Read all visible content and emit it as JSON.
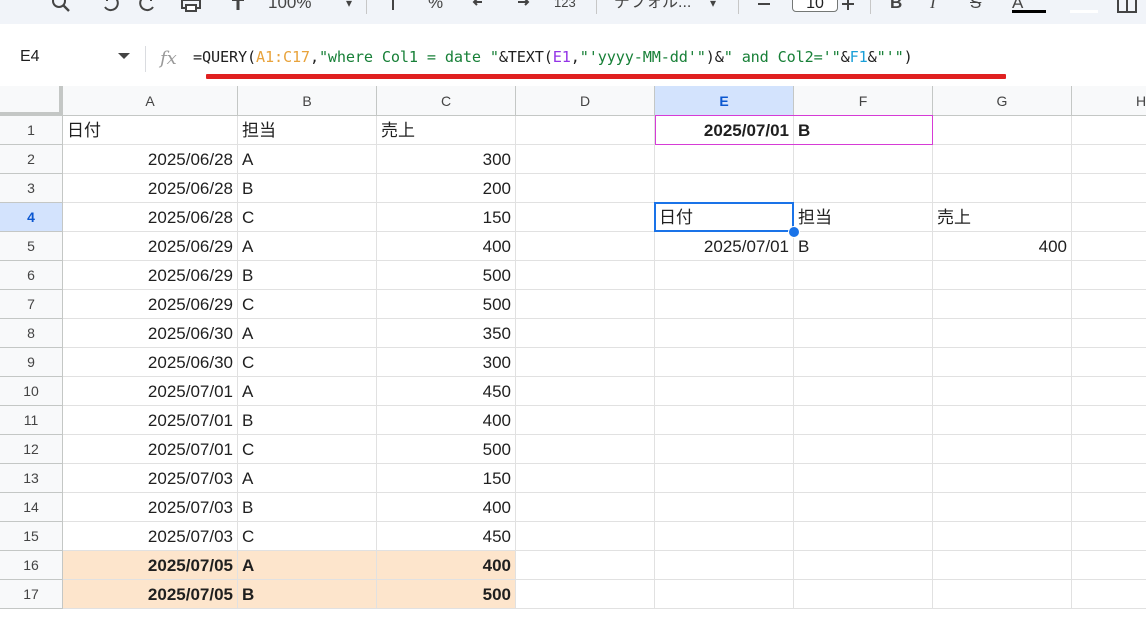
{
  "toolbar": {
    "zoom": "100%",
    "percent": "%",
    "number_format": "123",
    "font_name": "デフォル...",
    "font_size": "10",
    "bold": "B",
    "italic": "I",
    "strike": "S",
    "text_color": "A"
  },
  "formula_bar": {
    "name_box": "E4",
    "fx": "fx",
    "formula_segments": [
      {
        "text": "=QUERY(",
        "color": "#1f1f1f"
      },
      {
        "text": "A1:C17",
        "color": "#e8a33c"
      },
      {
        "text": ",",
        "color": "#1f1f1f"
      },
      {
        "text": "\"where Col1 = date \"",
        "color": "#188038"
      },
      {
        "text": "&TEXT(",
        "color": "#1f1f1f"
      },
      {
        "text": "E1",
        "color": "#9334e6"
      },
      {
        "text": ",",
        "color": "#1f1f1f"
      },
      {
        "text": "\"'yyyy-MM-dd'\"",
        "color": "#188038"
      },
      {
        "text": ")&",
        "color": "#1f1f1f"
      },
      {
        "text": "\" and Col2='\"",
        "color": "#188038"
      },
      {
        "text": "&",
        "color": "#1f1f1f"
      },
      {
        "text": "F1",
        "color": "#1a9fd8"
      },
      {
        "text": "&",
        "color": "#1f1f1f"
      },
      {
        "text": "\"'\"",
        "color": "#188038"
      },
      {
        "text": ")",
        "color": "#1f1f1f"
      }
    ],
    "underline_color": "#e02020"
  },
  "columns": [
    "A",
    "B",
    "C",
    "D",
    "E",
    "F",
    "G",
    "H"
  ],
  "selected_cell": {
    "col": "E",
    "row": 4
  },
  "highlight_color": "#fde5cc",
  "rows": [
    {
      "n": "1",
      "A": "日付",
      "B": "担当",
      "C": "売上",
      "E": "2025/07/01",
      "F": "B"
    },
    {
      "n": "2",
      "A": "2025/06/28",
      "B": "A",
      "C": "300"
    },
    {
      "n": "3",
      "A": "2025/06/28",
      "B": "B",
      "C": "200"
    },
    {
      "n": "4",
      "A": "2025/06/28",
      "B": "C",
      "C": "150",
      "E": "日付",
      "F": "担当",
      "G": "売上"
    },
    {
      "n": "5",
      "A": "2025/06/29",
      "B": "A",
      "C": "400",
      "E": "2025/07/01",
      "F": "B",
      "G": "400"
    },
    {
      "n": "6",
      "A": "2025/06/29",
      "B": "B",
      "C": "500"
    },
    {
      "n": "7",
      "A": "2025/06/29",
      "B": "C",
      "C": "500"
    },
    {
      "n": "8",
      "A": "2025/06/30",
      "B": "A",
      "C": "350"
    },
    {
      "n": "9",
      "A": "2025/06/30",
      "B": "C",
      "C": "300"
    },
    {
      "n": "10",
      "A": "2025/07/01",
      "B": "A",
      "C": "450"
    },
    {
      "n": "11",
      "A": "2025/07/01",
      "B": "B",
      "C": "400"
    },
    {
      "n": "12",
      "A": "2025/07/01",
      "B": "C",
      "C": "500"
    },
    {
      "n": "13",
      "A": "2025/07/03",
      "B": "A",
      "C": "150"
    },
    {
      "n": "14",
      "A": "2025/07/03",
      "B": "B",
      "C": "400"
    },
    {
      "n": "15",
      "A": "2025/07/03",
      "B": "C",
      "C": "450"
    },
    {
      "n": "16",
      "A": "2025/07/05",
      "B": "A",
      "C": "400",
      "hl": true
    },
    {
      "n": "17",
      "A": "2025/07/05",
      "B": "B",
      "C": "500",
      "hl": true
    }
  ]
}
